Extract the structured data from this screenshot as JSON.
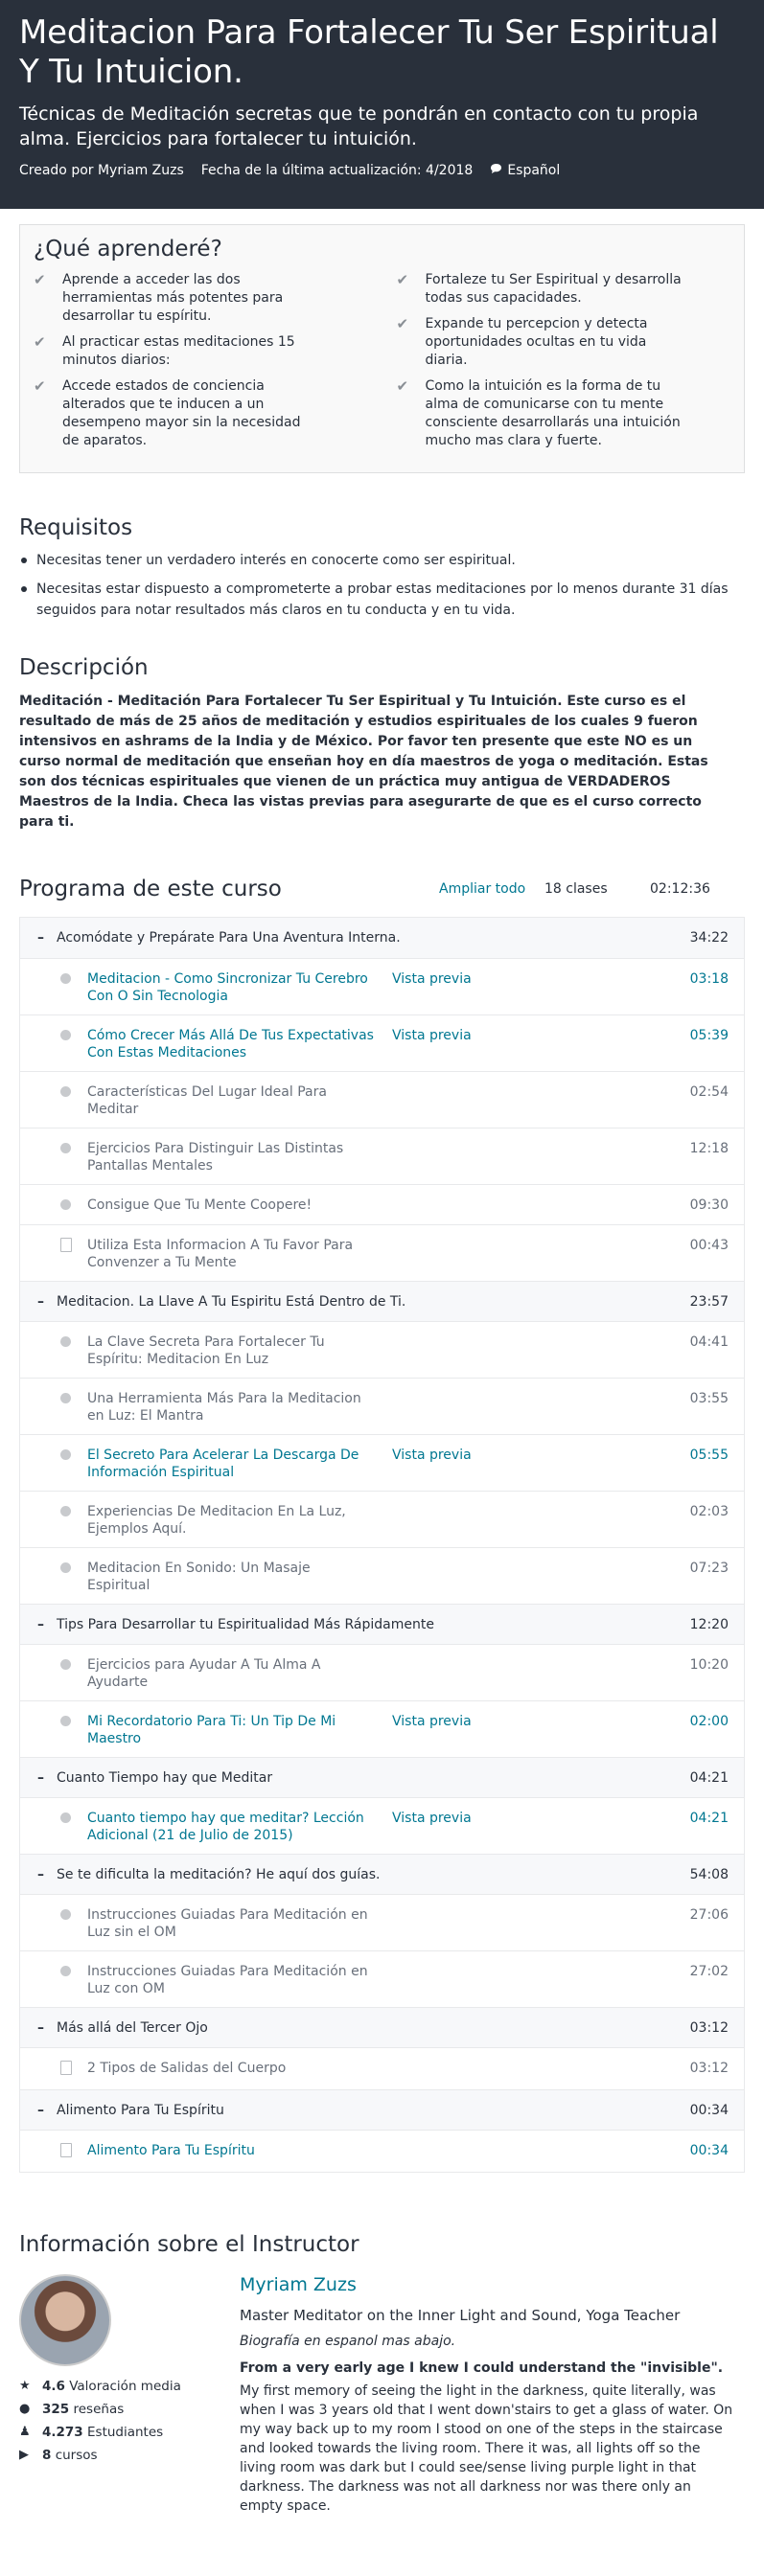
{
  "hero": {
    "title": "Meditacion Para Fortalecer Tu Ser Espiritual Y Tu Intuicion.",
    "subtitle": "Técnicas de Meditación secretas que te pondrán en contacto con tu propia alma. Ejercicios para fortalecer tu intuición.",
    "creator": "Creado por Myriam Zuzs",
    "updated": "Fecha de la última actualización: 4/2018",
    "language": "Español"
  },
  "learn": {
    "title": "¿Qué aprenderé?",
    "left": [
      "Aprende a acceder las dos herramientas más potentes para desarrollar tu espíritu.",
      "Al practicar estas meditaciones 15 minutos diarios:",
      "Accede estados de conciencia alterados que te inducen a un desempeno mayor sin la necesidad de aparatos."
    ],
    "right": [
      "Fortaleze tu Ser Espiritual y desarrolla todas sus capacidades.",
      "Expande tu percepcion y detecta oportunidades ocultas en tu vida diaria.",
      "Como la intuición es la forma de tu alma de comunicarse con tu mente consciente desarrollarás una intuición mucho mas clara y fuerte."
    ]
  },
  "requirements": {
    "title": "Requisitos",
    "items": [
      "Necesitas tener un verdadero interés en conocerte como ser espiritual.",
      "Necesitas estar dispuesto a comprometerte a probar estas meditaciones por lo menos durante 31 días seguidos para notar resultados más claros en tu conducta y en tu vida."
    ]
  },
  "description": {
    "title": "Descripción",
    "text": "Meditación - Meditación Para Fortalecer Tu Ser Espiritual y Tu Intuición. Este curso es el resultado de más de 25 años de meditación y estudios espirituales de los cuales 9 fueron intensivos en ashrams de la India y de México. Por favor ten presente que este NO es un curso normal de meditación que enseñan hoy en día maestros de yoga o meditación.  Estas son dos técnicas espirituales que vienen de un práctica muy antigua de VERDADEROS Maestros de la India. Checa las vistas previas para asegurarte de que es el curso correcto para ti."
  },
  "program": {
    "title": "Programa de este curso",
    "expand": "Ampliar todo",
    "count": "18 clases",
    "total": "02:12:36",
    "sections": [
      {
        "title": "Acomódate y Prepárate Para Una Aventura Interna.",
        "time": "34:22",
        "lectures": [
          {
            "title": "Meditacion - Como Sincronizar Tu Cerebro Con O Sin Tecnologia",
            "preview": "Vista previa",
            "time": "03:18"
          },
          {
            "title": "Cómo Crecer Más Allá De Tus Expectativas Con Estas Meditaciones",
            "preview": "Vista previa",
            "time": "05:39"
          },
          {
            "title": "Características Del Lugar Ideal Para Meditar",
            "preview": "",
            "time": "02:54"
          },
          {
            "title": "Ejercicios Para Distinguir Las Distintas Pantallas Mentales",
            "preview": "",
            "time": "12:18"
          },
          {
            "title": "Consigue Que Tu Mente Coopere!",
            "preview": "",
            "time": "09:30"
          },
          {
            "title": "Utiliza Esta Informacion A Tu Favor Para Convenzer a Tu Mente",
            "preview": "",
            "time": "00:43"
          }
        ]
      },
      {
        "title": "Meditacion. La Llave A Tu Espiritu Está Dentro de Ti.",
        "time": "23:57",
        "lectures": [
          {
            "title": "La Clave Secreta Para Fortalecer Tu Espíritu: Meditacion En Luz",
            "preview": "",
            "time": "04:41"
          },
          {
            "title": "Una Herramienta Más Para la Meditacion en Luz: El Mantra",
            "preview": "",
            "time": "03:55"
          },
          {
            "title": "El Secreto Para Acelerar La Descarga De Información Espiritual",
            "preview": "Vista previa",
            "time": "05:55"
          },
          {
            "title": "Experiencias De Meditacion En La Luz, Ejemplos Aquí.",
            "preview": "",
            "time": "02:03"
          },
          {
            "title": "Meditacion En Sonido: Un Masaje Espiritual",
            "preview": "",
            "time": "07:23"
          }
        ]
      },
      {
        "title": "Tips Para Desarrollar tu Espiritualidad Más Rápidamente",
        "time": "12:20",
        "lectures": [
          {
            "title": "Ejercicios para Ayudar A Tu Alma A Ayudarte",
            "preview": "",
            "time": "10:20"
          },
          {
            "title": "Mi Recordatorio Para Ti: Un Tip De Mi Maestro",
            "preview": "Vista previa",
            "time": "02:00"
          }
        ]
      },
      {
        "title": "Cuanto Tiempo hay que Meditar",
        "time": "04:21",
        "lectures": [
          {
            "title": "Cuanto tiempo hay que meditar? Lección Adicional (21 de Julio de 2015)",
            "preview": "Vista previa",
            "time": "04:21"
          }
        ]
      },
      {
        "title": "Se te dificulta la meditación? He aquí dos guías.",
        "time": "54:08",
        "lectures": [
          {
            "title": "Instrucciones Guiadas Para Meditación en Luz sin el OM",
            "preview": "",
            "time": "27:06"
          },
          {
            "title": "Instrucciones Guiadas Para Meditación en Luz con OM",
            "preview": "",
            "time": "27:02"
          }
        ]
      },
      {
        "title": "Más allá del Tercer Ojo",
        "time": "03:12",
        "lectures": [
          {
            "title": "2 Tipos de Salidas del Cuerpo",
            "preview": "",
            "time": "03:12"
          }
        ]
      },
      {
        "title": "Alimento Para Tu Espíritu",
        "time": "00:34",
        "lectures": [
          {
            "title": "Alimento Para Tu Espíritu",
            "preview": "",
            "time": "00:34"
          }
        ]
      }
    ]
  },
  "instructor": {
    "section_title": "Información sobre el Instructor",
    "name": "Myriam Zuzs",
    "headline": "Master Meditator on the Inner Light and Sound, Yoga Teacher",
    "italic": "Biografía en espanol mas abajo.",
    "bold": "From a very early age I knew I could understand the \"invisible\".",
    "bio": "My first memory of seeing the light in the darkness, quite literally, was when I was 3 years old that I went down'stairs to get a glass of water. On my way back up to my room I stood on one of the steps in the staircase and looked towards the living room. There it was, all lights off so the living room was dark but I could see/sense living purple light in that darkness. The darkness was not all darkness nor was there only an empty space.",
    "stats": [
      {
        "value": "4.6",
        "label": "Valoración media"
      },
      {
        "value": "325",
        "label": "reseñas"
      },
      {
        "value": "4.273",
        "label": "Estudiantes"
      },
      {
        "value": "8",
        "label": "cursos"
      }
    ]
  }
}
